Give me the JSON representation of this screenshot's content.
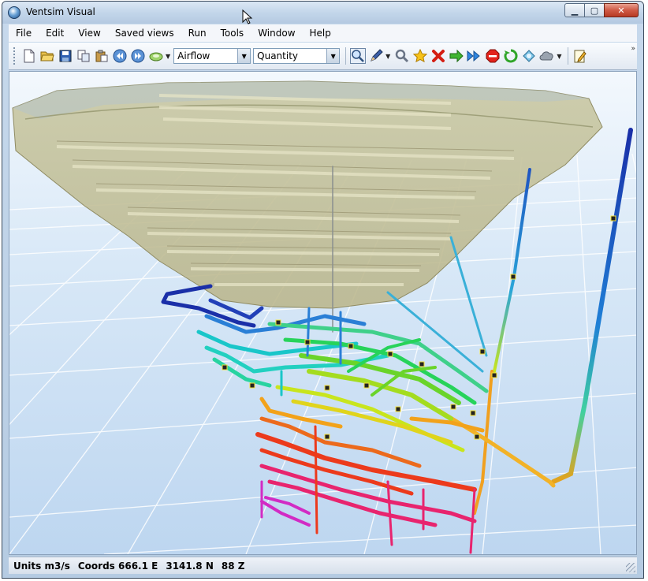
{
  "window": {
    "title": "Ventsim Visual"
  },
  "menu": [
    "File",
    "Edit",
    "View",
    "Saved views",
    "Run",
    "Tools",
    "Window",
    "Help"
  ],
  "toolbar": {
    "dropdown_1": "Airflow",
    "dropdown_2": "Quantity",
    "left_icons": [
      "new-file-icon",
      "open-folder-icon",
      "save-icon",
      "copy-icon",
      "paste-icon",
      "rewind-icon",
      "fast-forward-icon",
      "paint-icon"
    ],
    "right_icons": [
      "zoom-icon",
      "pencil-icon",
      "wrench-icon",
      "star-icon",
      "delete-x-icon",
      "green-arrow-icon",
      "blue-double-arrow-icon",
      "stop-sign-icon",
      "recycle-icon",
      "rotate-icon",
      "cloud-icon",
      "notepad-icon"
    ]
  },
  "status": {
    "units_label": "Units",
    "units_value": "m3/s",
    "coords_label": "Coords",
    "coords_e": "666.1 E",
    "coords_n": "3141.8 N",
    "coords_z": "88 Z"
  },
  "colors": {
    "airflow_scale": [
      "#1a2fa8",
      "#1f7fd6",
      "#19c6c9",
      "#27d35a",
      "#c8e51d",
      "#f2a21a",
      "#ec3a1c",
      "#e8246e",
      "#d22bc4"
    ]
  }
}
